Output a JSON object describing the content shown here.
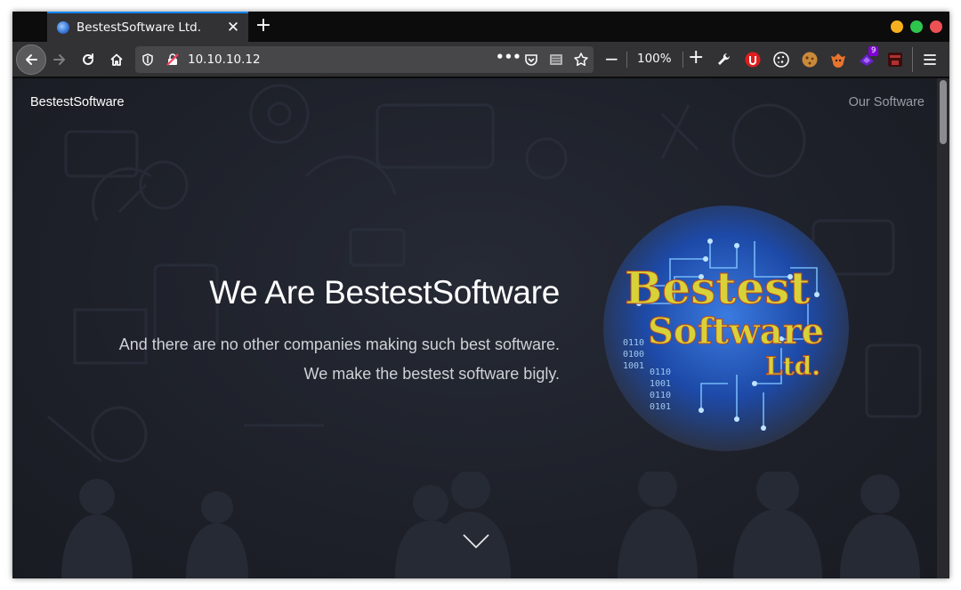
{
  "browser": {
    "tab": {
      "title": "BestestSoftware Ltd."
    },
    "url": "10.10.10.12",
    "zoom": "100%",
    "extension_badge": "9",
    "window_button_colors": {
      "minimize": "#f6b01e",
      "maximize": "#2ec64c",
      "close": "#ee5153"
    }
  },
  "page": {
    "brand": "BestestSoftware",
    "nav_link": "Our Software",
    "hero": {
      "title": "We Are BestestSoftware",
      "subtitle_line1": "And there are no other companies making such best software.",
      "subtitle_line2": "We make the bestest software bigly."
    },
    "logo": {
      "line1": "Bestest",
      "line2": "Software",
      "line3": "Ltd.",
      "binary_rows": [
        "0110",
        "0100",
        "1001",
        "0110",
        "1001",
        "0110",
        "0101"
      ]
    }
  },
  "colors": {
    "accent": "#0a84ff",
    "toolbar": "#323234",
    "page_bg": "#1e212a",
    "logo_text": "#d7d23a"
  }
}
